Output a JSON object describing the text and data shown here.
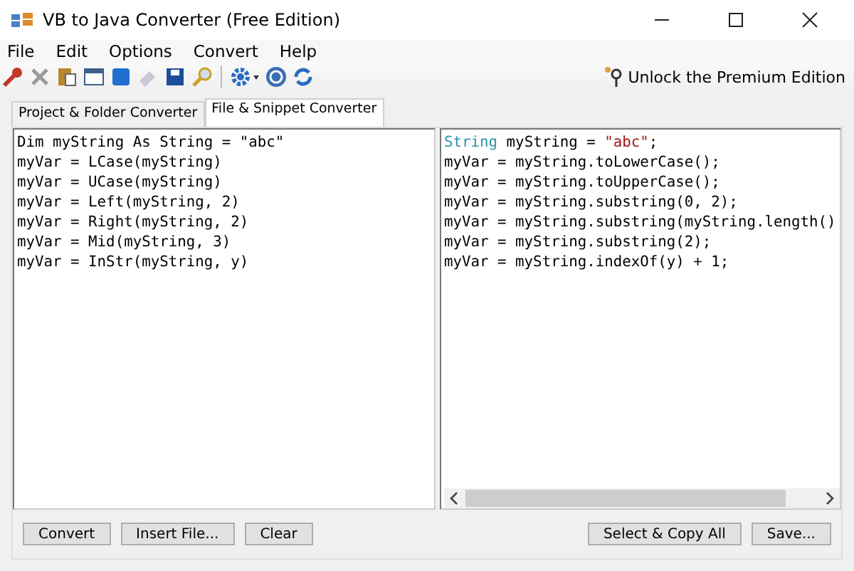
{
  "window": {
    "title": "VB to Java Converter (Free Edition)"
  },
  "menu": [
    "File",
    "Edit",
    "Options",
    "Convert",
    "Help"
  ],
  "toolbar": {
    "unlock_link": "Unlock the Premium Edition"
  },
  "tabs": [
    {
      "label": "Project & Folder Converter",
      "selected": false
    },
    {
      "label": "File & Snippet Converter",
      "selected": true
    }
  ],
  "vb_code": [
    "Dim myString As String = \"abc\"",
    "myVar = LCase(myString)",
    "myVar = UCase(myString)",
    "myVar = Left(myString, 2)",
    "myVar = Right(myString, 2)",
    "myVar = Mid(myString, 3)",
    "myVar = InStr(myString, y)"
  ],
  "java_code": [
    [
      {
        "text": "String",
        "kind": "type"
      },
      {
        "text": " myString = ",
        "kind": "plain"
      },
      {
        "text": "\"abc\"",
        "kind": "string"
      },
      {
        "text": ";",
        "kind": "plain"
      }
    ],
    [
      {
        "text": "myVar = myString.toLowerCase();",
        "kind": "plain"
      }
    ],
    [
      {
        "text": "myVar = myString.toUpperCase();",
        "kind": "plain"
      }
    ],
    [
      {
        "text": "myVar = myString.substring(0, 2);",
        "kind": "plain"
      }
    ],
    [
      {
        "text": "myVar = myString.substring(myString.length()",
        "kind": "plain"
      }
    ],
    [
      {
        "text": "myVar = myString.substring(2);",
        "kind": "plain"
      }
    ],
    [
      {
        "text": "myVar = myString.indexOf(y) + 1;",
        "kind": "plain"
      }
    ]
  ],
  "left_buttons": [
    "Convert",
    "Insert File...",
    "Clear"
  ],
  "right_buttons": [
    "Select & Copy All",
    "Save..."
  ]
}
